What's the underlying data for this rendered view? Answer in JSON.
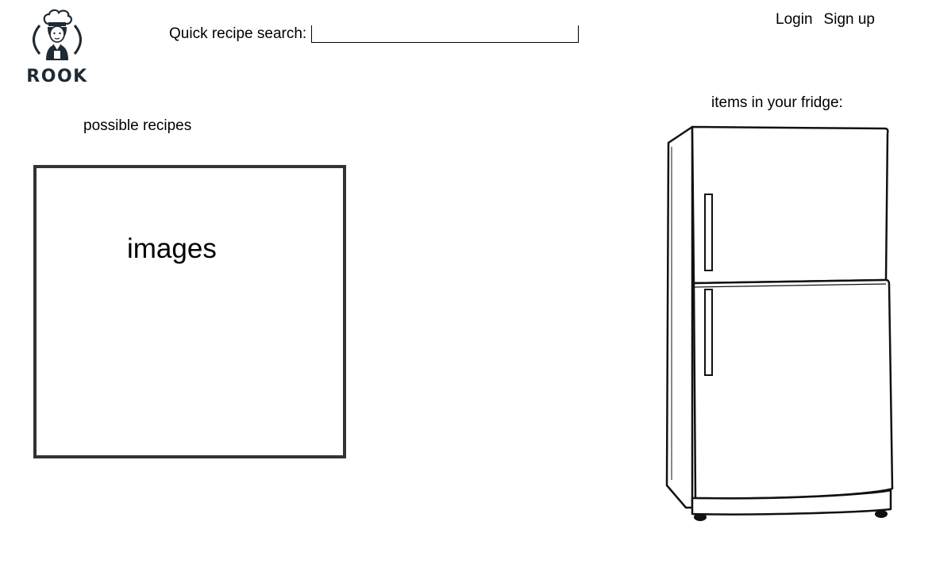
{
  "brand": {
    "name": "ROOK",
    "logo_icon": "chef-icon"
  },
  "header": {
    "search": {
      "label": "Quick recipe search:",
      "value": "",
      "placeholder": ""
    },
    "auth": {
      "login_label": "Login",
      "signup_label": "Sign up"
    }
  },
  "recipes": {
    "title": "possible recipes",
    "images_label": "images"
  },
  "fridge": {
    "title": "items in your fridge:",
    "icon": "refrigerator-icon"
  }
}
